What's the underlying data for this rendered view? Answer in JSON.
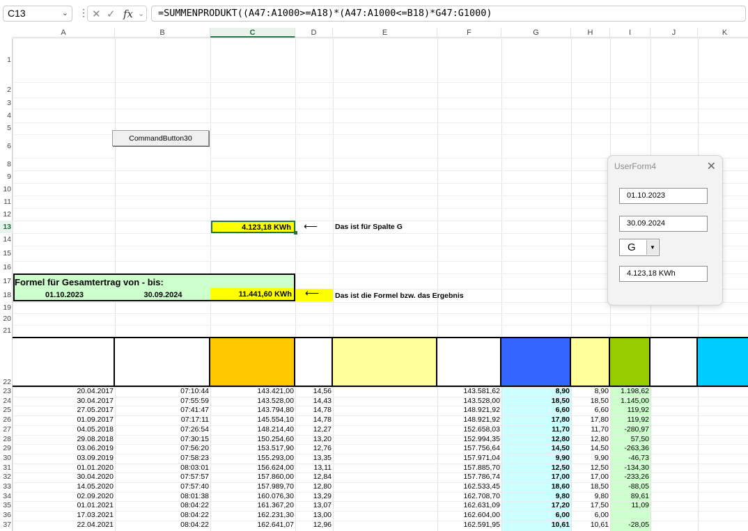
{
  "formula_bar": {
    "name_box": "C13",
    "formula": "=SUMMENPRODUKT((A47:A1000>=A18)*(A47:A1000<=B18)*G47:G1000)"
  },
  "columns": [
    "A",
    "B",
    "C",
    "D",
    "E",
    "F",
    "G",
    "H",
    "I",
    "J",
    "K"
  ],
  "row_numbers": [
    "1",
    "2",
    "3",
    "4",
    "5",
    "6",
    "8",
    "9",
    "10",
    "11",
    "12",
    "13",
    "14",
    "15",
    "16",
    "17",
    "18",
    "19",
    "20",
    "21",
    "22",
    "23",
    "24",
    "25",
    "26",
    "27",
    "28",
    "29",
    "30",
    "31",
    "32",
    "33",
    "34",
    "35",
    "36",
    "37"
  ],
  "command_button": "CommandButton30",
  "cells": {
    "c13": "4.123,18 KWh",
    "note13": "Das ist für Spalte G",
    "a17": "Formel für Gesamtertrag von - bis:",
    "a18": "01.10.2023",
    "b18": "30.09.2024",
    "c18": "11.441,60 KWh",
    "note18": "Das ist die Formel bzw. das Ergebnis",
    "arrow": "⟵"
  },
  "header_fills": {
    "C": "#ffc800",
    "E": "#ffff99",
    "G": "#3366ff",
    "H": "#ffff99",
    "I": "#99cc00",
    "K": "#00ccff"
  },
  "colors": {
    "yellow": "#ffff00",
    "light_green": "#ccffcc",
    "light_cyan": "#ccffff",
    "pale_green": "#ccffcc"
  },
  "table": [
    {
      "row": "23",
      "a": "20.04.2017",
      "b": "07:10:44",
      "c": "143.421,00",
      "d": "14,56",
      "f": "143.581,62",
      "g": "8,90",
      "h": "8,90",
      "i": "1.198,62"
    },
    {
      "row": "24",
      "a": "30.04.2017",
      "b": "07:55:59",
      "c": "143.528,00",
      "d": "14,43",
      "f": "143.528,00",
      "g": "18,50",
      "h": "18,50",
      "i": "1.145,00"
    },
    {
      "row": "25",
      "a": "27.05.2017",
      "b": "07:41:47",
      "c": "143.794,80",
      "d": "14,78",
      "f": "148.921,92",
      "g": "6,60",
      "h": "6,60",
      "i": "119,92"
    },
    {
      "row": "26",
      "a": "01.09.2017",
      "b": "07:17:11",
      "c": "145.554,10",
      "d": "14,78",
      "f": "148.921,92",
      "g": "17,80",
      "h": "17,80",
      "i": "119,92"
    },
    {
      "row": "27",
      "a": "04.05.2018",
      "b": "07:26:54",
      "c": "148.214,40",
      "d": "12,27",
      "f": "152.658,03",
      "g": "11,70",
      "h": "11,70",
      "i": "-280,97"
    },
    {
      "row": "28",
      "a": "29.08.2018",
      "b": "07:30:15",
      "c": "150.254,60",
      "d": "13,20",
      "f": "152.994,35",
      "g": "12,80",
      "h": "12,80",
      "i": "57,50"
    },
    {
      "row": "29",
      "a": "03.06.2019",
      "b": "07:56:20",
      "c": "153.517,90",
      "d": "12,76",
      "f": "157.756,64",
      "g": "14,50",
      "h": "14,50",
      "i": "-263,36"
    },
    {
      "row": "30",
      "a": "03.09.2019",
      "b": "07:58:23",
      "c": "155.293,00",
      "d": "13,35",
      "f": "157.971,04",
      "g": "9,90",
      "h": "9,90",
      "i": "-46,73"
    },
    {
      "row": "31",
      "a": "01.01.2020",
      "b": "08:03:01",
      "c": "156.624,00",
      "d": "13,11",
      "f": "157.885,70",
      "g": "12,50",
      "h": "12,50",
      "i": "-134,30"
    },
    {
      "row": "32",
      "a": "30.04.2020",
      "b": "07:57:57",
      "c": "157.860,00",
      "d": "12,84",
      "f": "157.786,74",
      "g": "17,00",
      "h": "17,00",
      "i": "-233,26"
    },
    {
      "row": "33",
      "a": "14.05.2020",
      "b": "07:57:40",
      "c": "157.989,70",
      "d": "12,80",
      "f": "162.533,45",
      "g": "18,60",
      "h": "18,50",
      "i": "-88,05"
    },
    {
      "row": "34",
      "a": "02.09.2020",
      "b": "08:01:38",
      "c": "160.076,30",
      "d": "13,29",
      "f": "162.708,70",
      "g": "9,80",
      "h": "9,80",
      "i": "89,61"
    },
    {
      "row": "35",
      "a": "01.01.2021",
      "b": "08:04:22",
      "c": "161.367,20",
      "d": "13,07",
      "f": "162.631,09",
      "g": "17,20",
      "h": "17,50",
      "i": "11,09"
    },
    {
      "row": "36",
      "a": "17.03.2021",
      "b": "08:04:22",
      "c": "162.231,30",
      "d": "13,00",
      "f": "162.604,00",
      "g": "6,00",
      "h": "6,00",
      "i": ""
    },
    {
      "row": "37",
      "a": "22.04.2021",
      "b": "08:04:22",
      "c": "162.641,07",
      "d": "12,96",
      "f": "162.591,95",
      "g": "10,61",
      "h": "10,61",
      "i": "-28,05"
    }
  ],
  "userform": {
    "title": "UserForm4",
    "close": "✕",
    "date_from": "01.10.2023",
    "date_to": "30.09.2024",
    "column": "G",
    "result": "4.123,18 KWh"
  }
}
